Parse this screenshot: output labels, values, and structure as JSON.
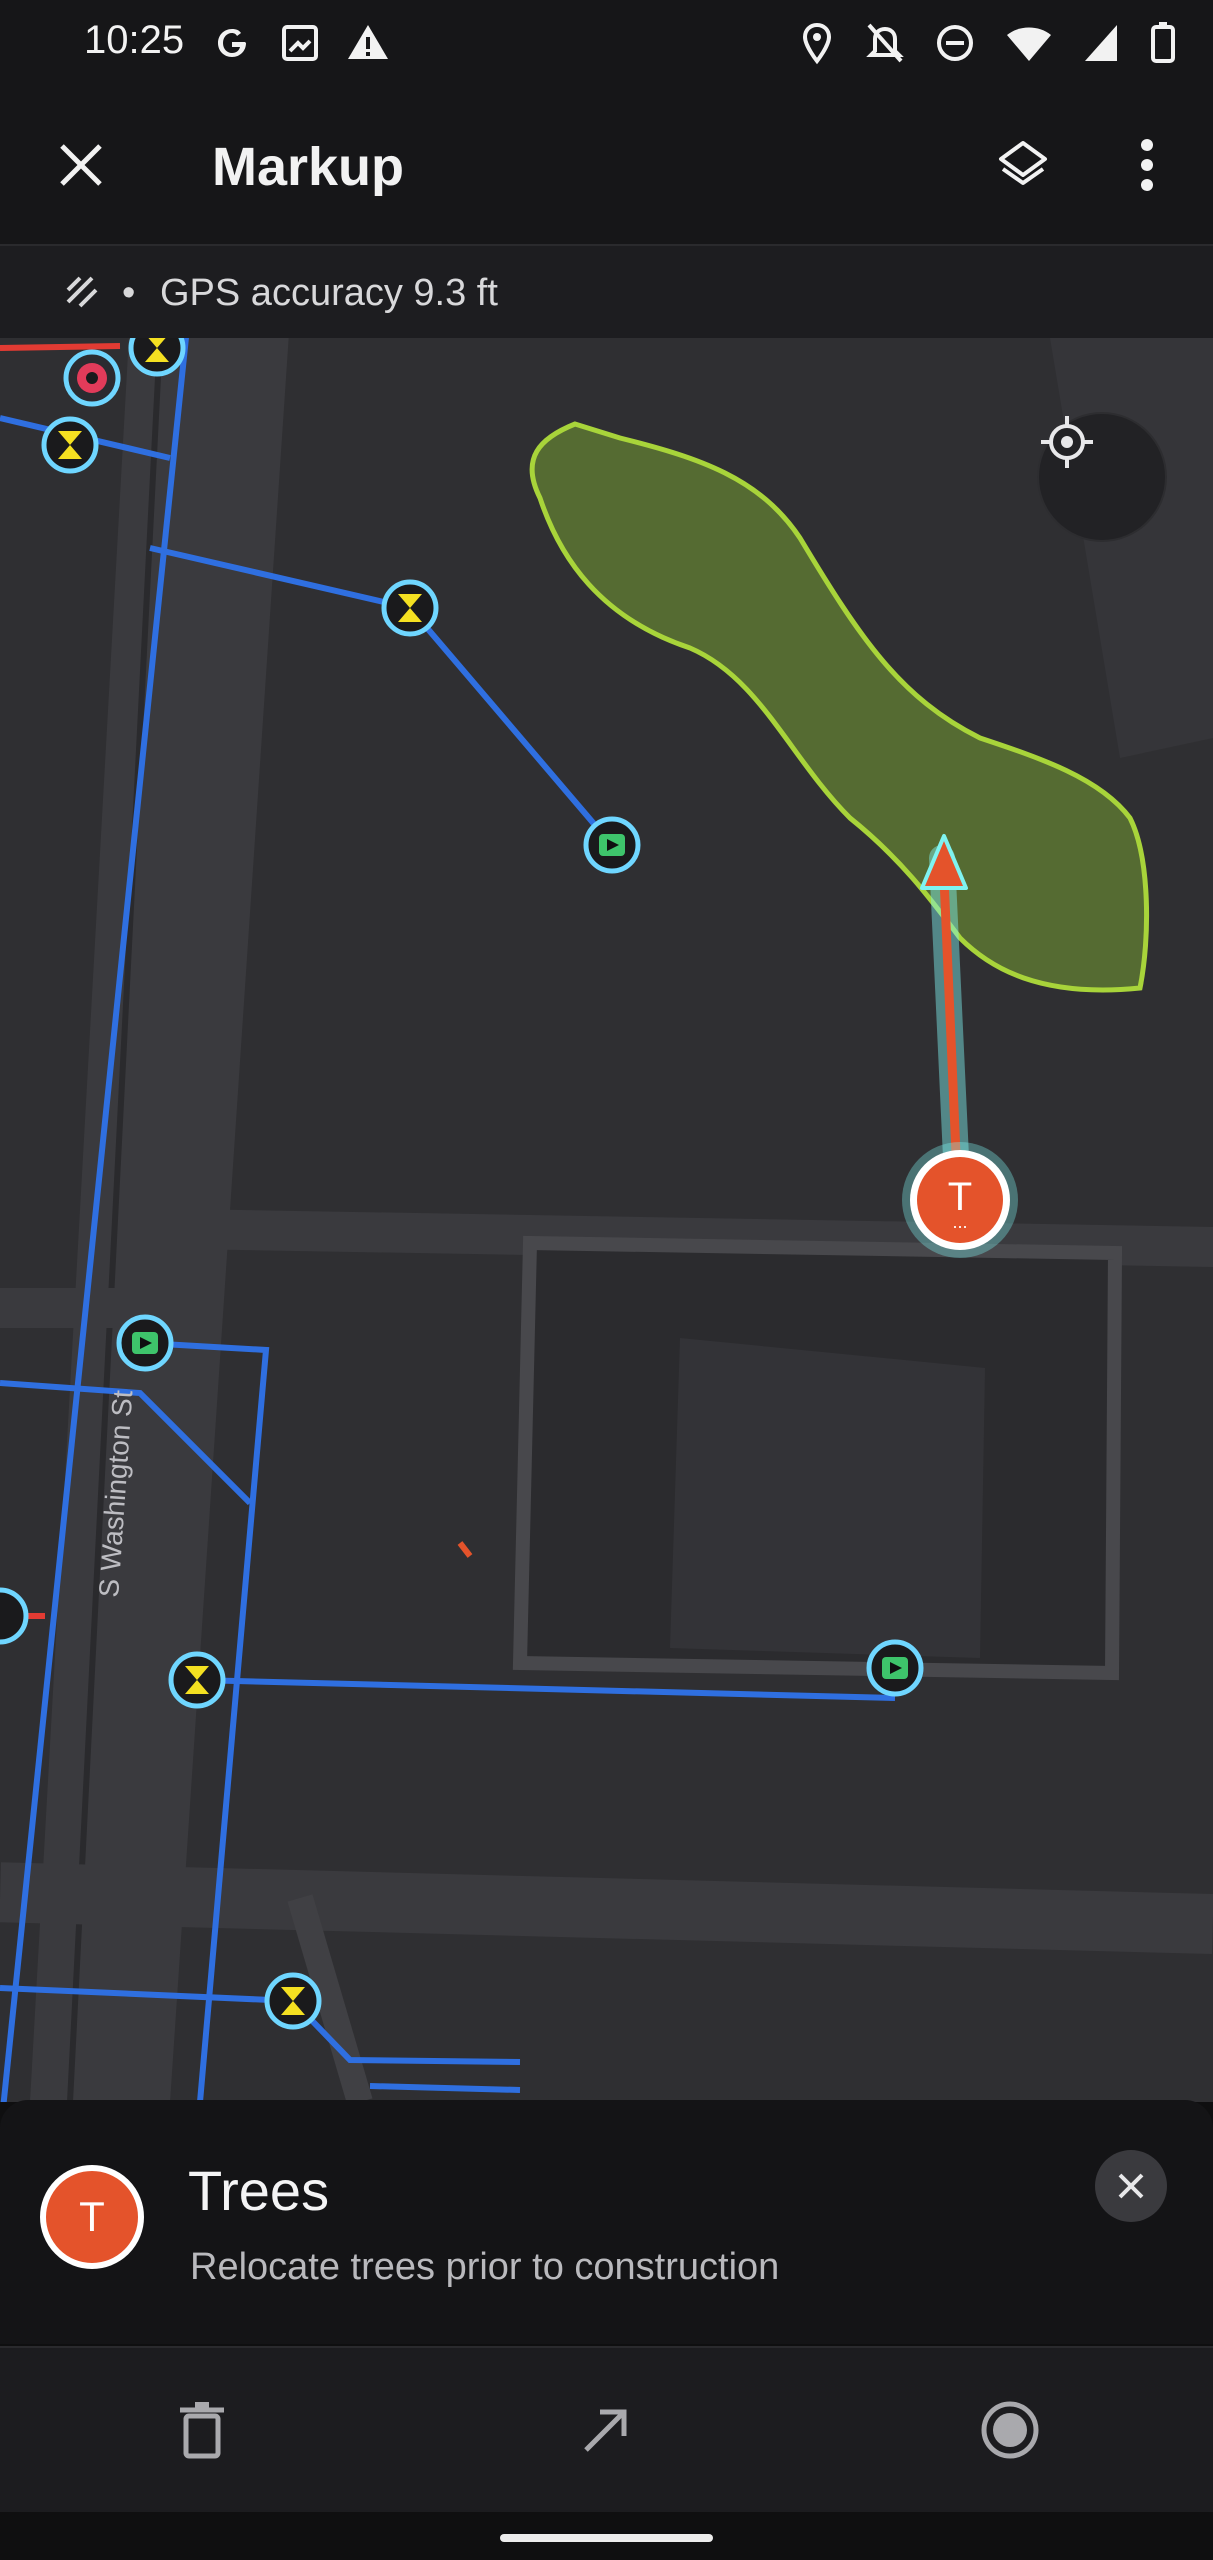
{
  "status_bar": {
    "time": "10:25"
  },
  "app_bar": {
    "title": "Markup"
  },
  "gps": {
    "accuracy_text": "GPS accuracy 9.3 ft",
    "separator": "•"
  },
  "map": {
    "street_label": "S Washington St",
    "marker_letter": "T",
    "marker_dots": "..."
  },
  "sheet": {
    "title": "Trees",
    "subtitle": "Relocate trees prior to construction",
    "avatar_letter": "T"
  },
  "colors": {
    "accent": "#e4532b",
    "polygon_fill": "#556b32",
    "polygon_stroke": "#a8d43a",
    "utility_line": "#2f6fe0",
    "glow": "#7ff3f0"
  }
}
